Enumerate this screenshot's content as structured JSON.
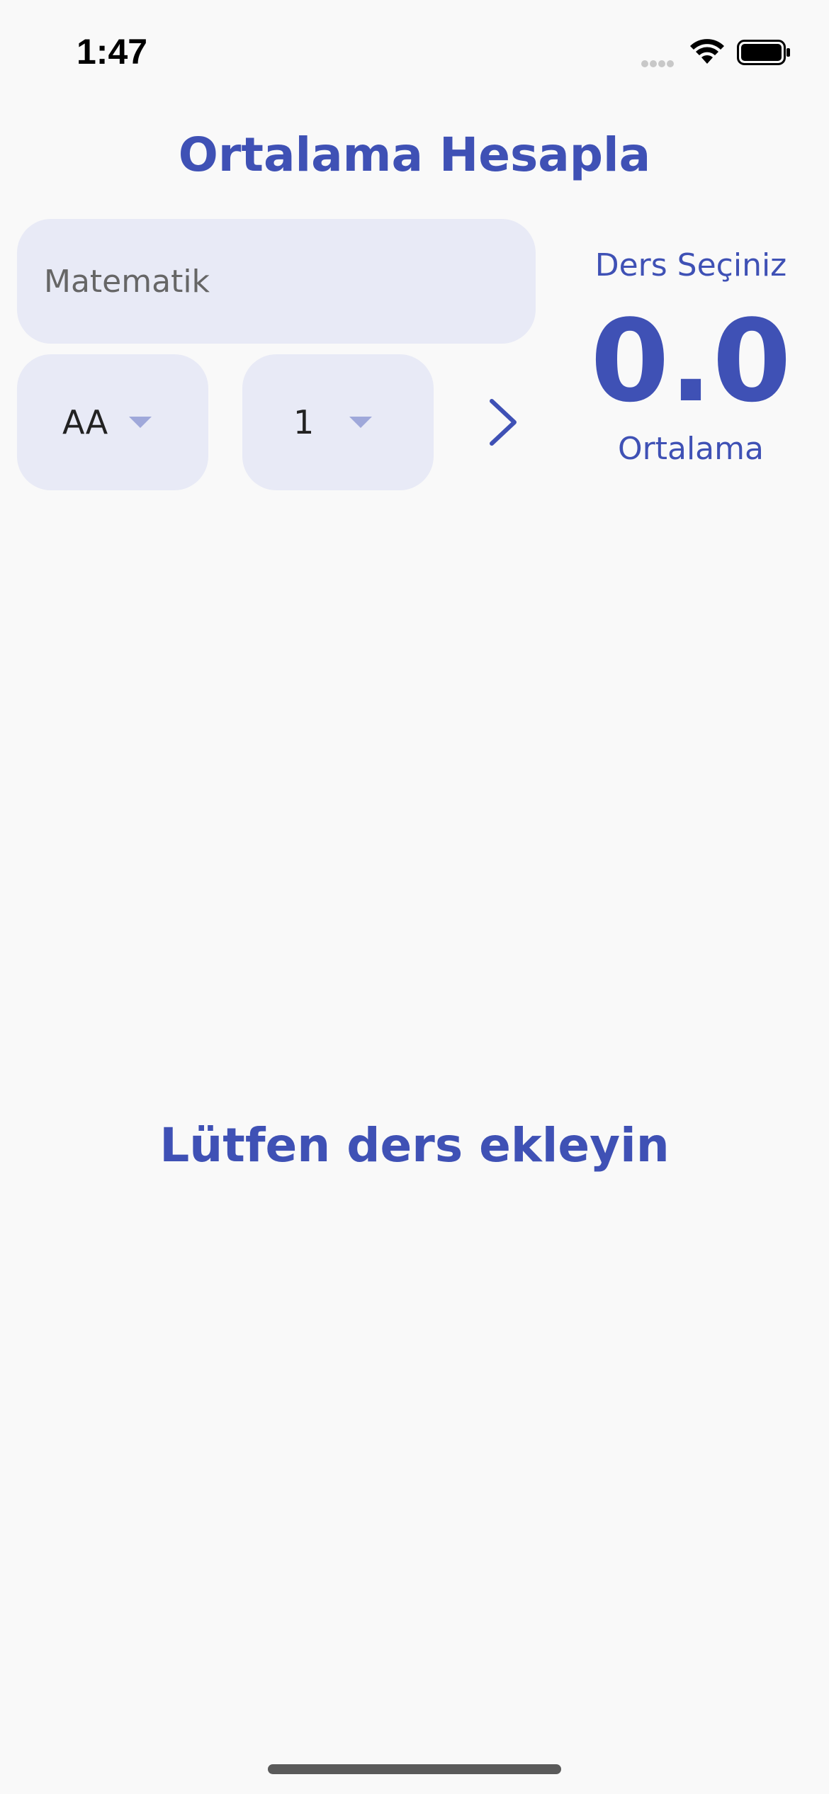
{
  "status_bar": {
    "time": "1:47"
  },
  "header": {
    "title": "Ortalama Hesapla"
  },
  "form": {
    "course_placeholder": "Matematik",
    "grade_selected": "AA",
    "credit_selected": "1",
    "add_icon": "chevron-right-icon"
  },
  "summary": {
    "select_label": "Ders Seçiniz",
    "average_value": "0.0",
    "average_label": "Ortalama"
  },
  "list": {
    "empty_message": "Lütfen ders ekleyin"
  },
  "colors": {
    "accent": "#3f51b5",
    "field_background": "#e8eaf6",
    "caret": "#9fa8da",
    "page_background": "#f9f9f9"
  }
}
